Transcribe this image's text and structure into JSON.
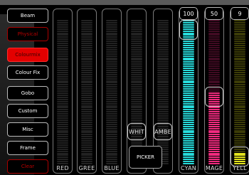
{
  "categories": [
    {
      "label": "Beam",
      "style": "normal"
    },
    {
      "label": "Physical",
      "style": "red"
    },
    {
      "label": "Colourmix",
      "style": "selected"
    },
    {
      "label": "Colour Fix",
      "style": "normal"
    },
    {
      "label": "Gobo",
      "style": "normal"
    },
    {
      "label": "Custom",
      "style": "normal"
    },
    {
      "label": "Misc",
      "style": "normal"
    },
    {
      "label": "Frame",
      "style": "normal"
    },
    {
      "label": "Clear",
      "style": "red"
    }
  ],
  "faders": [
    {
      "key": "red",
      "label": "RED",
      "value": "",
      "level": 0.0,
      "color": "#ff2020"
    },
    {
      "key": "green",
      "label": "GREE",
      "value": "",
      "level": 0.0,
      "color": "#20ff20"
    },
    {
      "key": "blue",
      "label": "BLUE",
      "value": "",
      "level": 0.0,
      "color": "#2020ff"
    },
    {
      "key": "white",
      "label": "WHIT",
      "value": "",
      "level": 0.0,
      "color": "#ffffff"
    },
    {
      "key": "amber",
      "label": "AMBE",
      "value": "",
      "level": 0.0,
      "color": "#ffa020"
    },
    {
      "key": "cyan",
      "label": "CYAN",
      "value": "100",
      "level": 1.0,
      "color": "#29e8e8"
    },
    {
      "key": "magenta",
      "label": "MAGE",
      "value": "50",
      "level": 0.5,
      "color": "#ff2d86"
    },
    {
      "key": "yellow",
      "label": "YELL",
      "value": "9",
      "level": 0.09,
      "color": "#f0f020"
    }
  ],
  "picker": {
    "label": "PICKER"
  },
  "colors": {
    "selected": "#e30000",
    "red_text": "#b00000"
  }
}
